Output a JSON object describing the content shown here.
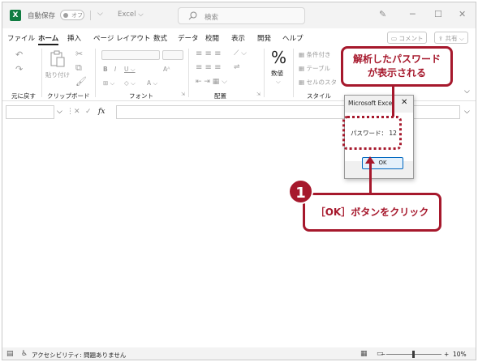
{
  "app": {
    "logo_letter": "X",
    "autosave_label": "自動保存",
    "autosave_state": "オフ",
    "doc_title": "Excel ⌵",
    "search_placeholder": "検索"
  },
  "menu": {
    "tabs": [
      "ファイル",
      "ホーム",
      "挿入",
      "ページ レイアウト",
      "数式",
      "データ",
      "校閲",
      "表示",
      "開発",
      "ヘルプ"
    ],
    "active_tab": "ホーム",
    "comment_label": "コメント",
    "share_label": "共有"
  },
  "ribbon": {
    "groups": {
      "undo": "元に戻す",
      "clipboard": "クリップボード",
      "font": "フォント",
      "alignment": "配置",
      "number": "数値",
      "styles": "スタイル"
    },
    "paste_label": "貼り付け",
    "number_symbol": "%",
    "styles_items": [
      "条件付き",
      "テーブル",
      "セルのスタ"
    ]
  },
  "formula_bar": {
    "fx_label": "fx"
  },
  "dialog": {
    "title": "Microsoft Excel",
    "close": "✕",
    "message": "パスワード：  12",
    "ok_label": "OK"
  },
  "annotations": {
    "callout_line1": "解析したパスワード",
    "callout_line2": "が表示される",
    "step_number": "1",
    "step_text": "［OK］ボタンをクリック",
    "accent_color": "#a6182c"
  },
  "status": {
    "accessibility": "アクセシビリティ: 問題ありません",
    "zoom": "10%"
  }
}
